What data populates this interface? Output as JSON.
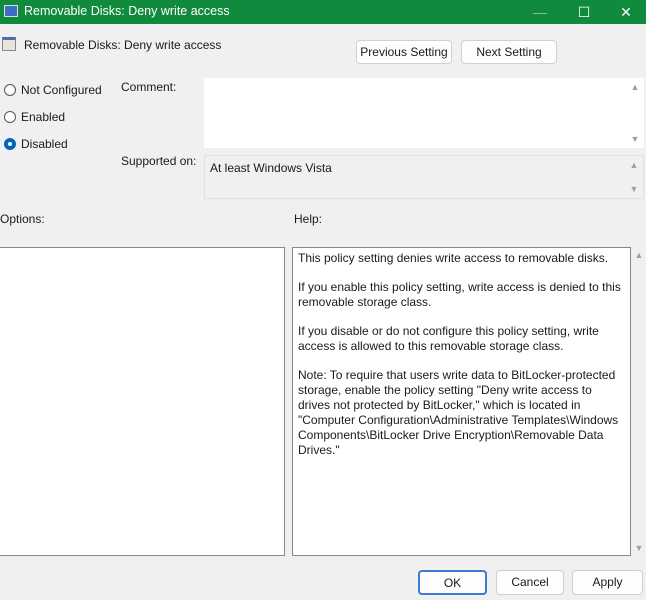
{
  "window": {
    "title": "Removable Disks: Deny write access",
    "minimize": "—",
    "maximize": "☐",
    "close": "✕"
  },
  "header": {
    "title": "Removable Disks: Deny write access",
    "previous": "Previous Setting",
    "next": "Next Setting"
  },
  "state": {
    "options": [
      "Not Configured",
      "Enabled",
      "Disabled"
    ],
    "selected": "Disabled"
  },
  "comment": {
    "label": "Comment:",
    "value": ""
  },
  "supported": {
    "label": "Supported on:",
    "value": "At least Windows Vista"
  },
  "options_label": "Options:",
  "help_label": "Help:",
  "help": [
    "This policy setting denies write access to removable disks.",
    "If you enable this policy setting, write access is denied to this removable storage class.",
    "If you disable or do not configure this policy setting, write access is allowed to this removable storage class.",
    "Note: To require that users write data to BitLocker-protected storage, enable the policy setting \"Deny write access to drives not protected by BitLocker,\" which is located in \"Computer Configuration\\Administrative Templates\\Windows Components\\BitLocker Drive Encryption\\Removable Data Drives.\""
  ],
  "footer": {
    "ok": "OK",
    "cancel": "Cancel",
    "apply": "Apply"
  }
}
